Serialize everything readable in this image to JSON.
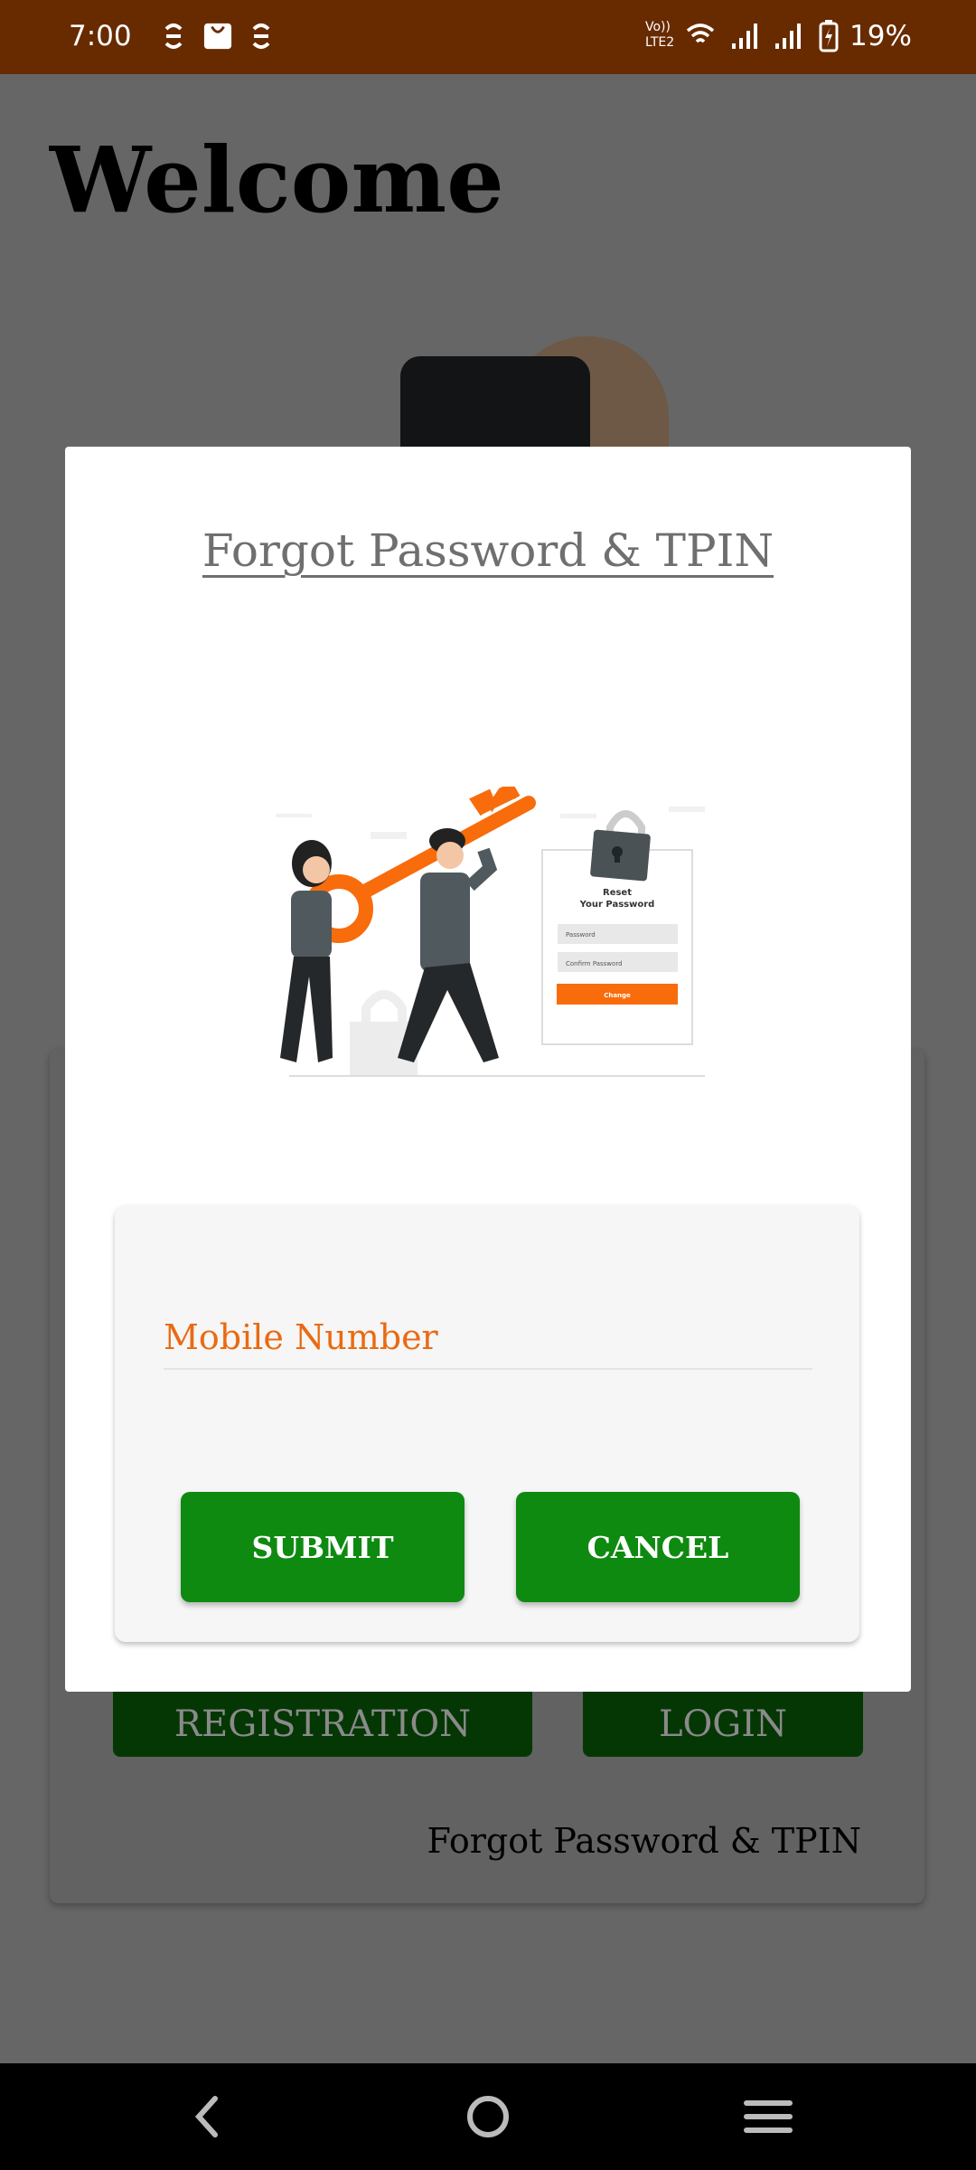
{
  "status_bar": {
    "time": "7:00",
    "battery_percent": "19%",
    "network_label": "Vo)) LTE2",
    "icons": [
      "notification-s-icon",
      "shopping-bag-icon",
      "notification-s-icon",
      "volte-icon",
      "wifi-icon",
      "signal-icon",
      "signal-icon",
      "battery-charging-icon"
    ],
    "background": "#682b00"
  },
  "background_page": {
    "title": "Welcome",
    "registration_label": "REGISTRATION",
    "login_label": "LOGIN",
    "forgot_link": "Forgot Password & TPIN"
  },
  "dialog": {
    "title": "Forgot Password & TPIN",
    "illustration": {
      "heading_line1": "Reset",
      "heading_line2": "Your Password",
      "field1": "Password",
      "field2": "Confirm Password",
      "button": "Change"
    },
    "mobile_placeholder": "Mobile Number",
    "mobile_value": "",
    "submit_label": "SUBMIT",
    "cancel_label": "CANCEL",
    "accent_color": "#ea6a12",
    "button_color": "#0e8a10"
  },
  "nav_bar": {
    "icons": [
      "back-icon",
      "home-icon",
      "recents-menu-icon"
    ]
  }
}
